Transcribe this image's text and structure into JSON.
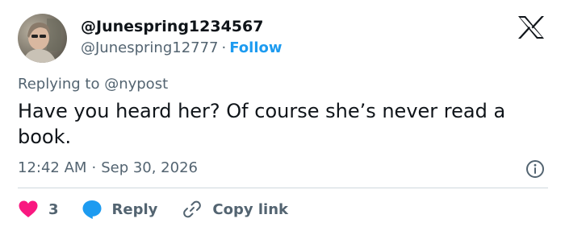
{
  "author": {
    "display_name": "@Junespring1234567",
    "handle": "@Junespring12777",
    "follow_label": "Follow",
    "separator": "·"
  },
  "logo": {
    "icon": "x-logo-icon"
  },
  "tweet": {
    "replying_to": "Replying to @nypost",
    "text": "Have you heard her? Of course she’s never read a book.",
    "time": "12:42 AM",
    "date": "Sep 30, 2026",
    "separator": "·"
  },
  "actions": {
    "like_count": "3",
    "reply_label": "Reply",
    "copy_link_label": "Copy link"
  },
  "colors": {
    "accent": "#1d9bf0",
    "like": "#f91880",
    "text": "#0f1419",
    "secondary": "#536471",
    "divider": "#cfd9de"
  }
}
